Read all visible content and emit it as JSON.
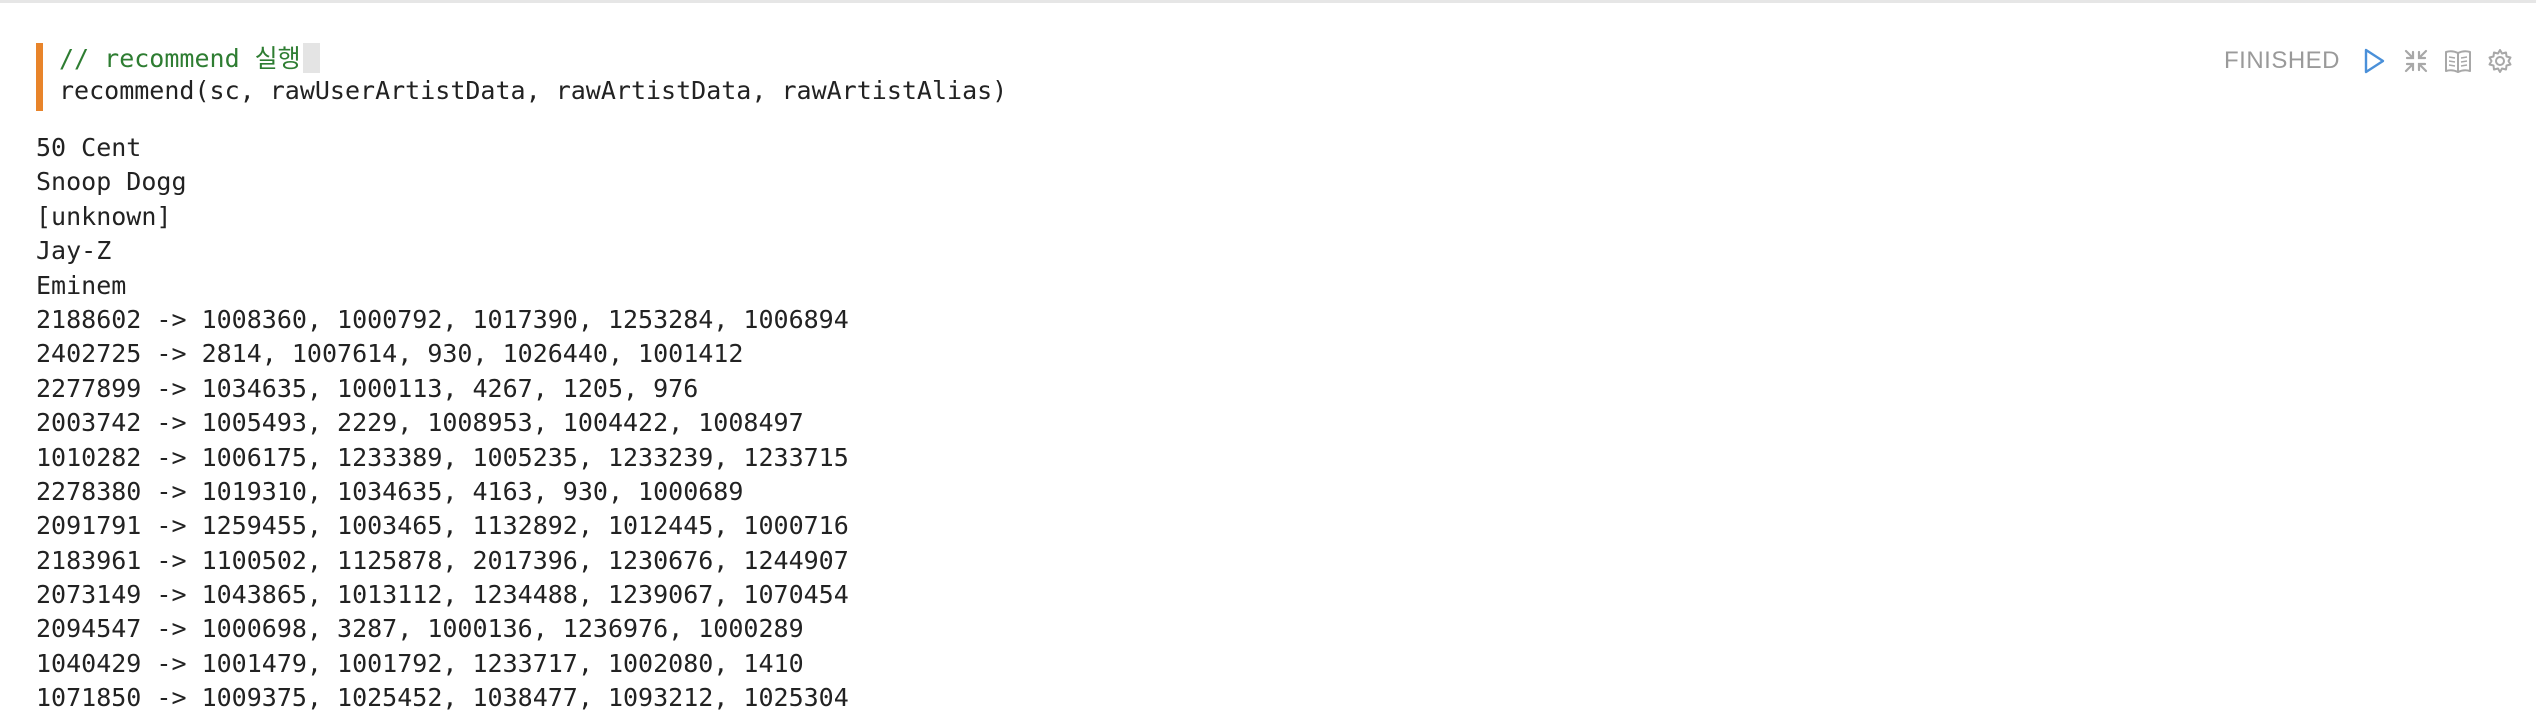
{
  "editor": {
    "comment_line": "// recommend 실행",
    "code_line": "recommend(sc, rawUserArtistData, rawArtistData, rawArtistAlias)"
  },
  "controls": {
    "status": "FINISHED",
    "icons": [
      "run-icon",
      "collapse-icon",
      "book-icon",
      "gear-icon"
    ],
    "run_color": "#4a90d9"
  },
  "output": {
    "lines": [
      "50 Cent",
      "Snoop Dogg",
      "[unknown]",
      "Jay-Z",
      "Eminem",
      "2188602 -> 1008360, 1000792, 1017390, 1253284, 1006894",
      "2402725 -> 2814, 1007614, 930, 1026440, 1001412",
      "2277899 -> 1034635, 1000113, 4267, 1205, 976",
      "2003742 -> 1005493, 2229, 1008953, 1004422, 1008497",
      "1010282 -> 1006175, 1233389, 1005235, 1233239, 1233715",
      "2278380 -> 1019310, 1034635, 4163, 930, 1000689",
      "2091791 -> 1259455, 1003465, 1132892, 1012445, 1000716",
      "2183961 -> 1100502, 1125878, 2017396, 1230676, 1244907",
      "2073149 -> 1043865, 1013112, 1234488, 1239067, 1070454",
      "2094547 -> 1000698, 3287, 1000136, 1236976, 1000289",
      "1040429 -> 1001479, 1001792, 1233717, 1002080, 1410",
      "1071850 -> 1009375, 1025452, 1038477, 1093212, 1025304"
    ]
  },
  "colors": {
    "accent_bar": "#e8842a",
    "comment": "#2e7d32",
    "status_text": "#9a9a9a"
  }
}
